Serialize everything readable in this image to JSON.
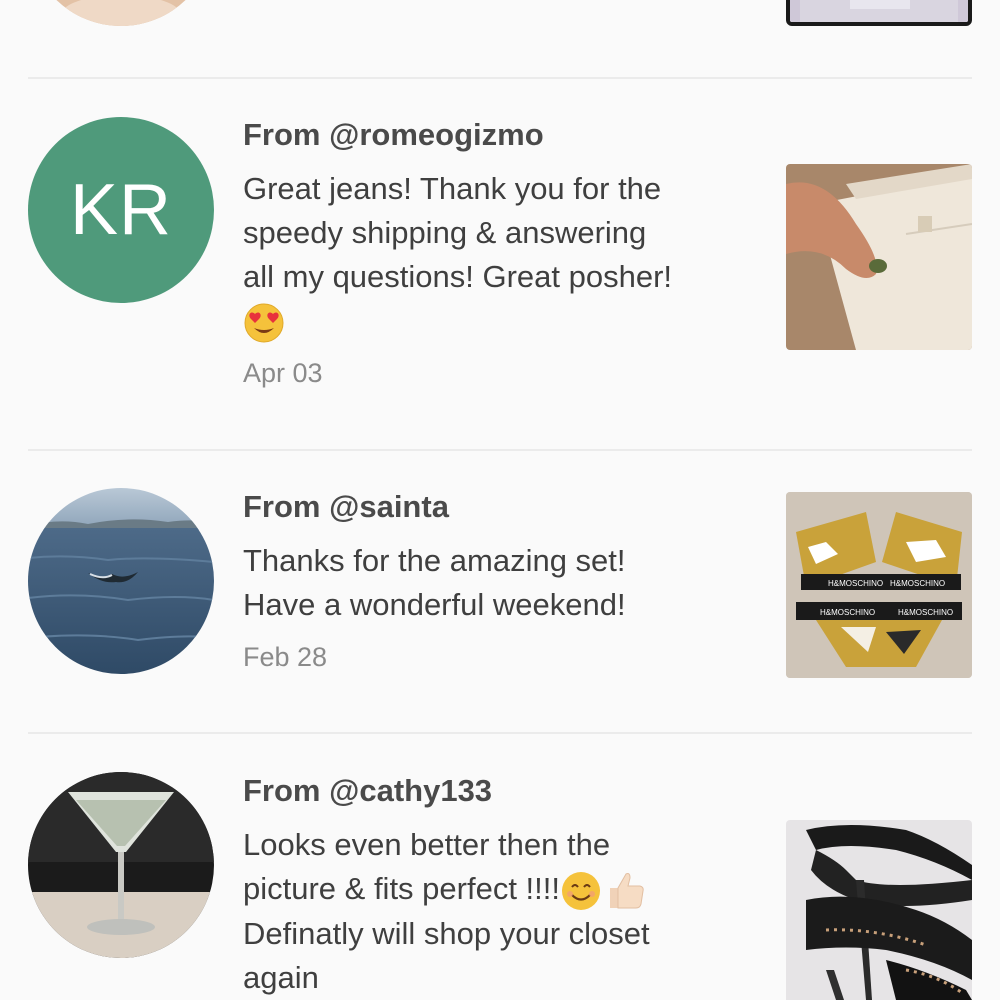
{
  "reviews": [
    {
      "from": "",
      "message": [],
      "date": ""
    },
    {
      "from": "From @romeogizmo",
      "avatar_initials": "KR",
      "avatar_color": "#4f9a7b",
      "message": [
        "Great jeans! Thank you for the",
        "speedy shipping & answering",
        "all my questions! Great posher!"
      ],
      "message_emoji": "heart-eyes-emoji",
      "date": "Apr 03"
    },
    {
      "from": "From @sainta",
      "message": [
        "Thanks for the amazing set!",
        "Have a wonderful weekend!"
      ],
      "date": "Feb 28",
      "thumb_labels": [
        "H&MOSCHINO",
        "H&MOSCHINO",
        "H&MOSCHINO",
        "H&MOSCHINO"
      ]
    },
    {
      "from": "From @cathy133",
      "message": [
        "Looks even better then the",
        "picture & fits perfect !!!!",
        "Definatly will shop your closet",
        "again"
      ],
      "message_emojis": [
        "smiling-face-emoji",
        "thumbs-up-emoji"
      ],
      "date": ""
    }
  ],
  "colors": {
    "background": "#fafafa",
    "divider": "#ebebeb",
    "text": "#3f3f3f",
    "muted": "#8a8a8a"
  }
}
